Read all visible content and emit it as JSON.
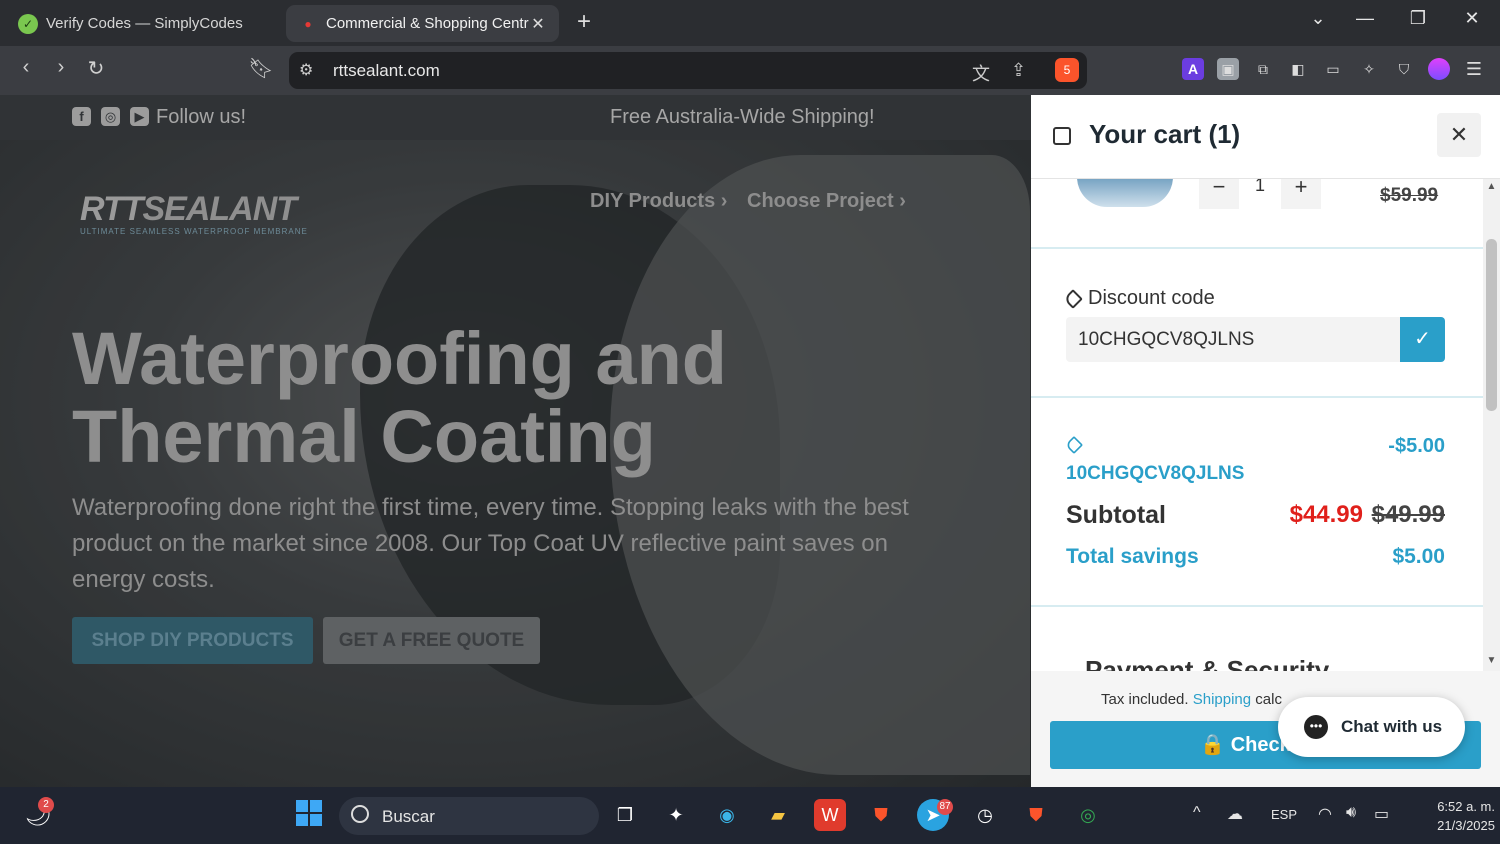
{
  "browser": {
    "tabs": [
      {
        "title": "Verify Codes — SimplyCodes",
        "active": false
      },
      {
        "title": "Commercial & Shopping Centre",
        "active": true
      }
    ],
    "url": "rttsealant.com",
    "shield_count": "5"
  },
  "site": {
    "follow_us": "Follow us!",
    "shipping_banner": "Free Australia-Wide Shipping!",
    "logo_text_a": "RTT",
    "logo_text_b": "SEALANT",
    "logo_tagline": "ULTIMATE SEAMLESS WATERPROOF MEMBRANE",
    "nav": [
      "DIY Products ›",
      "Choose Project ›"
    ],
    "hero_title": "Waterproofing and Thermal Coating",
    "hero_subtitle": "Waterproofing done right the first time, every time. Stopping leaks with the best product on the market since 2008. Our Top Coat UV reflective paint saves on energy costs.",
    "cta_primary": "SHOP DIY PRODUCTS",
    "cta_secondary": "GET A FREE QUOTE"
  },
  "cart": {
    "title": "Your cart (1)",
    "close": "✕",
    "item": {
      "quantity": "1",
      "compare_price": "$59.99"
    },
    "discount_label": "Discount code",
    "discount_value": "10CHGQCV8QJLNS",
    "applied": {
      "code": "10CHGQCV8QJLNS",
      "amount": "-$5.00"
    },
    "subtotal_label": "Subtotal",
    "subtotal_price": "$44.99",
    "subtotal_compare": "$49.99",
    "savings_label": "Total savings",
    "savings_value": "$5.00",
    "payment_heading_peek": "Payment & Security",
    "tax_note_prefix": "Tax included.",
    "tax_note_link": "Shipping",
    "tax_note_suffix": "calc",
    "checkout_label": "🔒 Check Out",
    "chat_label": "Chat with us"
  },
  "taskbar": {
    "search_placeholder": "Buscar",
    "language": "ESP",
    "time": "6:52 a. m.",
    "date": "21/3/2025",
    "weather_badge": "2",
    "telegram_badge": "87"
  },
  "colors": {
    "accent": "#2a9fc9",
    "sale_red": "#e0201b"
  }
}
